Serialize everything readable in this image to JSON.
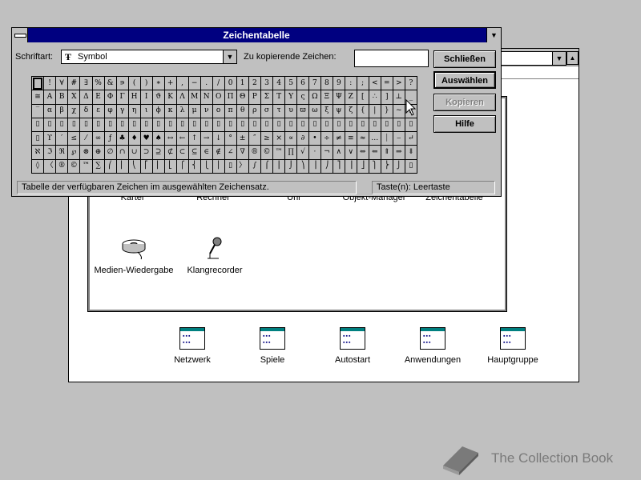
{
  "program_manager": {
    "accessories_icons": [
      {
        "label": "Kartei"
      },
      {
        "label": "Rechner"
      },
      {
        "label": "Uhr"
      },
      {
        "label": "Objekt-Manager"
      },
      {
        "label": "Zeichentabelle"
      },
      {
        "label": "Medien-Wiedergabe"
      },
      {
        "label": "Klangrecorder"
      }
    ],
    "groups": [
      {
        "label": "Netzwerk"
      },
      {
        "label": "Spiele"
      },
      {
        "label": "Autostart"
      },
      {
        "label": "Anwendungen"
      },
      {
        "label": "Hauptgruppe"
      }
    ]
  },
  "charmap": {
    "title": "Zeichentabelle",
    "font_label": "Schriftart:",
    "font_value": "Symbol",
    "copy_label": "Zu kopierende Zeichen:",
    "copy_value": "",
    "buttons": {
      "close": "Schließen",
      "select": "Auswählen",
      "copy": "Kopieren",
      "help": "Hilfe"
    },
    "grid_rows": [
      " !∀#∃%&∍()∗+,−./0123456789:;<=>?",
      "≅ΑΒΧΔΕΦΓΗΙϑΚΛΜΝΟΠΘΡΣΤΥςΩΞΨΖ[∴]⊥_",
      "‾αβχδεφγηιϕκλμνοπθρστυϖωξψζ{|}~▯",
      "▯▯▯▯▯▯▯▯▯▯▯▯▯▯▯▯▯▯▯▯▯▯▯▯▯▯▯▯▯▯▯▯",
      "▯ϒ′≤⁄∞ƒ♣♦♥♠↔←↑→↓°±″≥×∝∂•÷≠≡≈…⏐⎯↵",
      "ℵℑℜ℘⊗⊕∅∩∪⊃⊇⊄⊂⊆∈∉∠∇®©™∏√⋅¬∧∨⇔⇐⇑⇒⇓",
      "◊〈®©™∑⎛⎜⎝⎡⎢⎣⎧⎨⎩⎪▯〉∫⌠⎮⌡⎞⎟⎠⎤⎥⎦⎫⎬⎭▯"
    ],
    "status_left": "Tabelle der verfügbaren Zeichen im ausgewählten Zeichensatz.",
    "status_right": "Taste(n): Leertaste"
  },
  "watermark": "The Collection Book"
}
